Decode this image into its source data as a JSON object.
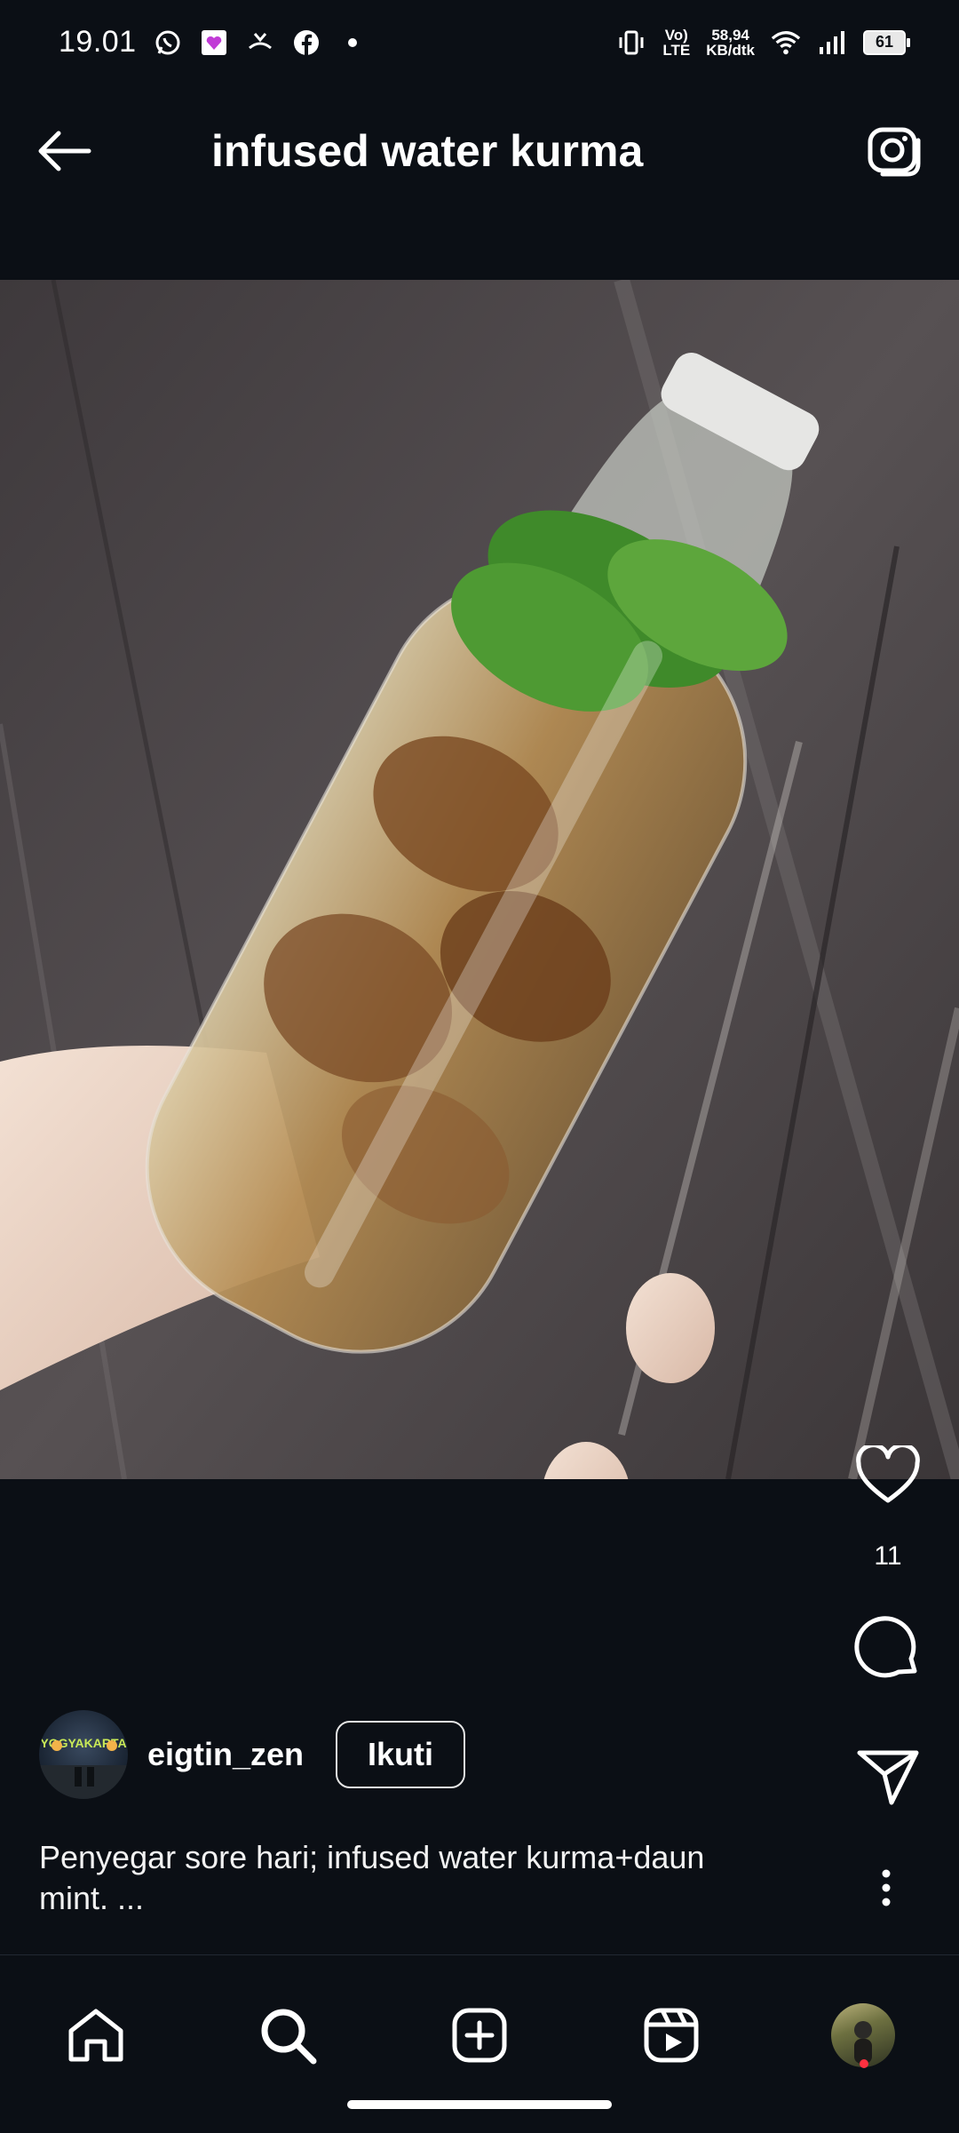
{
  "status_bar": {
    "time": "19.01",
    "network_type_top": "Vo)",
    "network_type_bottom": "LTE",
    "speed_value": "58,94",
    "speed_unit": "KB/dtk",
    "battery": "61"
  },
  "header": {
    "title": "infused water kurma"
  },
  "post": {
    "like_count": "11",
    "username": "eigtin_zen",
    "follow_label": "Ikuti",
    "caption_line1": "Penyegar sore hari; infused water kurma+daun",
    "caption_line2": "mint. ...",
    "avatar_text": "YOGYAKARTA"
  },
  "icons": {
    "back": "arrow-left-icon",
    "camera": "camera-icon",
    "like": "heart-icon",
    "comment": "comment-icon",
    "share": "send-icon",
    "more": "more-vertical-icon",
    "home": "home-icon",
    "search": "search-icon",
    "create": "plus-square-icon",
    "reels": "reels-icon"
  },
  "colors": {
    "background": "#0b0f15",
    "notification_dot": "#ff3040"
  }
}
